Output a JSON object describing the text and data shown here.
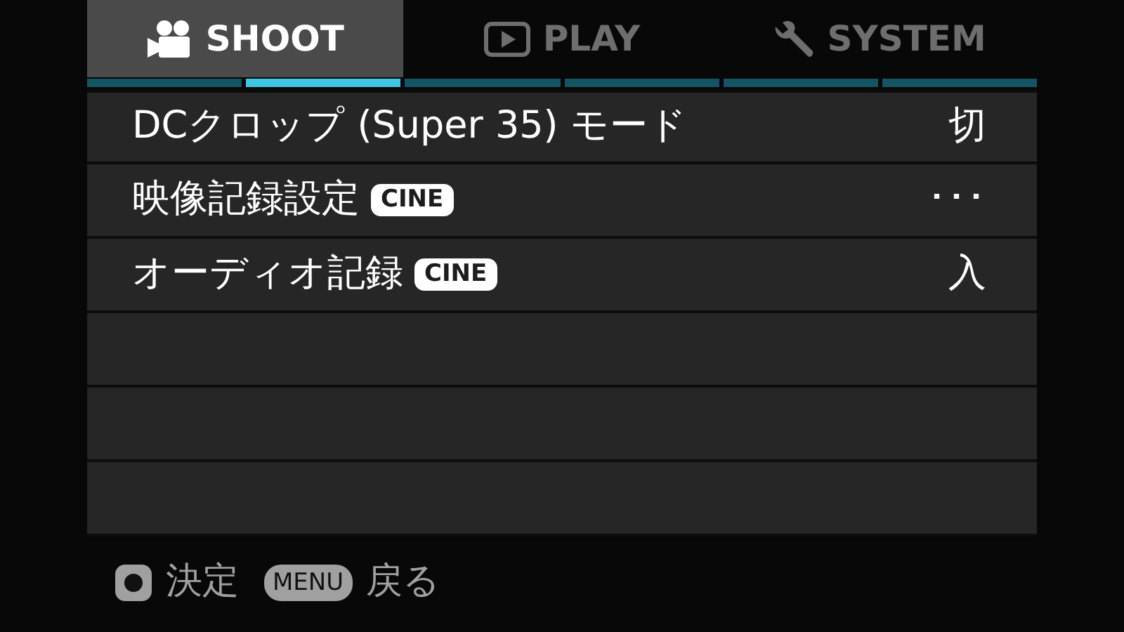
{
  "tabs": [
    {
      "label": "SHOOT",
      "kind": "camera",
      "selected": true
    },
    {
      "label": "PLAY",
      "kind": "play",
      "selected": false
    },
    {
      "label": "SYSTEM",
      "kind": "wrench",
      "selected": false
    }
  ],
  "pages": [
    {
      "selected": false
    },
    {
      "selected": true
    },
    {
      "selected": false
    },
    {
      "selected": false
    },
    {
      "selected": false
    },
    {
      "selected": false
    }
  ],
  "rows": [
    {
      "kind": "setting",
      "label": "DCクロップ (Super 35) モード",
      "value": "切"
    },
    {
      "kind": "setting",
      "label": "映像記録設定",
      "badge": "CINE",
      "value": "･･･"
    },
    {
      "kind": "setting",
      "label": "オーディオ記録",
      "badge": "CINE",
      "value": "入"
    },
    {
      "kind": "empty"
    },
    {
      "kind": "empty"
    },
    {
      "kind": "empty"
    }
  ],
  "hints": [
    {
      "kind": "button",
      "action": "決定"
    },
    {
      "kind": "key",
      "key": "MENU",
      "action": "戻る"
    }
  ]
}
